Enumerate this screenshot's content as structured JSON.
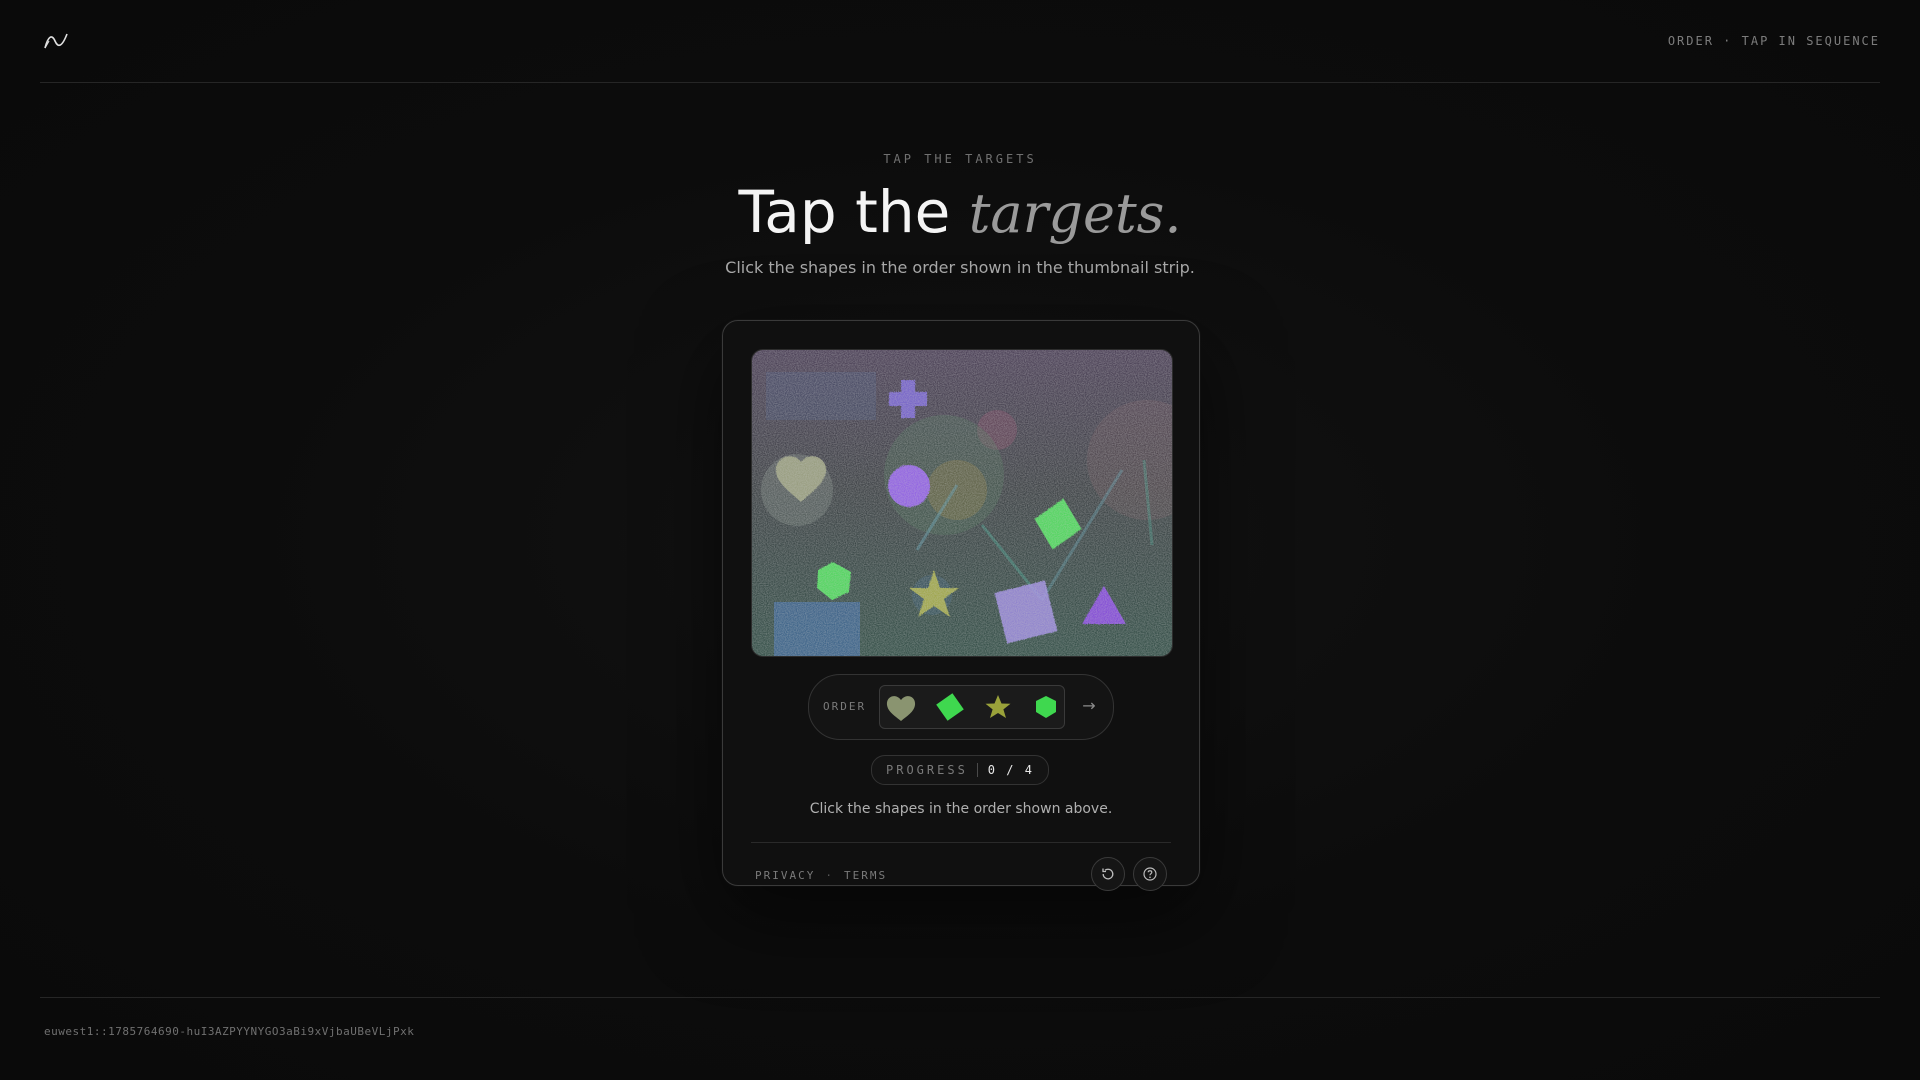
{
  "header": {
    "meta": "ORDER · TAP IN SEQUENCE"
  },
  "hero": {
    "eyebrow": "TAP THE TARGETS",
    "title_main": "Tap the",
    "title_accent": "targets.",
    "subtitle": "Click the shapes in the order shown in the thumbnail strip."
  },
  "challenge": {
    "order_label": "ORDER",
    "order_sequence": [
      "heart",
      "diamond",
      "star",
      "hexagon"
    ],
    "next_arrow": "→",
    "progress_label": "PROGRESS",
    "progress_value": "0 / 4",
    "progress_fraction": 0,
    "instruction": "Click the shapes in the order shown above.",
    "links": {
      "privacy": "PRIVACY",
      "separator": "·",
      "terms": "TERMS"
    },
    "icons": [
      "refresh-icon",
      "help-icon"
    ]
  },
  "footer": {
    "id": "euwest1::1785764690-huI3AZPYYNYGO3aBi9xVjbaUBeVLjPxk"
  },
  "colors": {
    "background": "#0c0c0c",
    "card": "#101010",
    "green_shape": "#3fd84f",
    "purple_shape": "#8a55e6",
    "olive_star": "#9aa23a",
    "khaki_heart": "#8f9a6a"
  }
}
